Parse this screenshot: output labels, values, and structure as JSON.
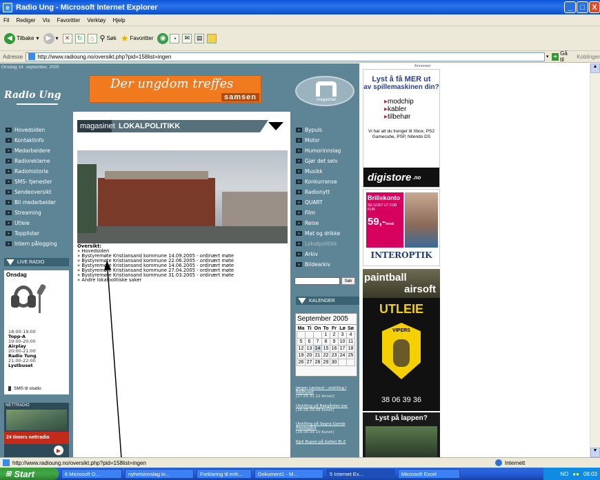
{
  "window": {
    "title": "Radio Ung - Microsoft Internet Explorer",
    "min": "_",
    "max": "□",
    "close": "X"
  },
  "menu": [
    "Fil",
    "Rediger",
    "Vis",
    "Favoritter",
    "Verktøy",
    "Hjelp"
  ],
  "toolbar": {
    "back": "Tilbake",
    "search": "Søk",
    "favorites": "Favoritter"
  },
  "address": {
    "label": "Adresse",
    "url": "http://www.radioung.no/oversikt.php?pid=158list=ingen",
    "go": "Gå til",
    "links": "Koblinger"
  },
  "page": {
    "date": "Onsdag 14. september, 2005",
    "logo": "Radio Ung",
    "banner": {
      "line1": "Der ungdom treffes",
      "line2": "samsen"
    },
    "magasinet_logo": "magasinet",
    "section": {
      "a": "magasinet",
      "b": "LOKALPOLITIKK"
    },
    "annonser": "Annonser",
    "left_nav": [
      "Hovedsiden",
      "Kontaktinfo",
      "Medarbeidere",
      "Radioreklame",
      "Radiohistorie",
      "SMS- tjenester",
      "Sendeoversikt",
      "Bli medarbeider",
      "Streaming",
      "Utleie",
      "Topplister",
      "Intern pålogging"
    ],
    "live_radio": "LIVE RADIO",
    "day": "Onsdag",
    "programs": [
      {
        "time": "18:00-19:00",
        "name": "Topp-A"
      },
      {
        "time": "19:00-20:00",
        "name": "Airplay"
      },
      {
        "time": "20:00-21:00",
        "name": "Radio Tung"
      },
      {
        "time": "21:00-22:00",
        "name": "Lystbuset"
      }
    ],
    "sms_studio": "SMS til studio",
    "nettradio": "NETTRADIO",
    "nettradio_caption": "24 timers nettradio",
    "right_nav": [
      "Bypuls",
      "Motor",
      "Humorinnslag",
      "Gjør det selv",
      "Musikk",
      "Konkurranse",
      "Radionytt",
      "QUART",
      "Film",
      "Reise",
      "Mat og drikke",
      "Lokalpolitikk",
      "Arkiv",
      "Bildearkiv"
    ],
    "search_button": "Søk",
    "kalender": "KALENDER",
    "calendar": {
      "month": "September 2005",
      "headers": [
        "Ma",
        "Ti",
        "On",
        "To",
        "Fr",
        "Lø",
        "Sø"
      ],
      "rows": [
        [
          "",
          "",
          "",
          "1",
          "2",
          "3",
          "4"
        ],
        [
          "5",
          "6",
          "7",
          "8",
          "9",
          "10",
          "11"
        ],
        [
          "12",
          "13",
          "14",
          "15",
          "16",
          "17",
          "18"
        ],
        [
          "19",
          "20",
          "21",
          "22",
          "23",
          "24",
          "25"
        ],
        [
          "26",
          "27",
          "28",
          "29",
          "30",
          "",
          ""
        ]
      ]
    },
    "events": [
      {
        "title": "Jørgen Løvland - utstilling i Rådhuset",
        "date": "[27.05-31.12 Annet]"
      },
      {
        "title": "Utstilling på Bakgården bar",
        "date": "[26.08-29.09 Kunst]"
      },
      {
        "title": "Utstilling på Sagna Gamle Prestegård",
        "date": "[28.08-09.10 Kunst]"
      },
      {
        "title": "Kjell Nupen på Galleri Bi-Z",
        "date": ""
      }
    ],
    "oversikt": {
      "heading": "Oversikt:",
      "items": [
        "Hovedsiden",
        "Bystyremøte Kristiansand kommune 14.09.2005 - ordinært møte",
        "Bystyremøte Kristiansand kommune 22.06.2005 - ordinært møte",
        "Bystyremøte Kristiansand kommune 14.06.2005 - ordinært møte",
        "Bystyremøte Kristiansand kommune 27.04.2005 - ordinært møte",
        "Bystyremøte Kristiansand kommune 31.03.2005 - ordinært møte",
        "Andre lokalpolitiske saker"
      ]
    },
    "ads": {
      "digistore": {
        "h1": "Lyst å få MER ut",
        "h2": "av spillemaskinen din?",
        "bullets": [
          "modchip",
          "kabler",
          "tilbehør"
        ],
        "body": "Vi har alt du trenger til Xbox, PS2 Gamecube, PSP, Nitendo DS",
        "brand": "digistore",
        "tld": ".no"
      },
      "interoptik": {
        "title": "Brillekonto",
        "sub": "SE GODT UT FOR KUN",
        "price": "59,-",
        "unit": "/mnd",
        "brand": "INTEROPTIK"
      },
      "paintball": {
        "l1": "paintball",
        "l2": "airsoft",
        "l3": "UTLEIE",
        "brand": "VIPERS",
        "phone": "38 06 39 36"
      },
      "lappen": "Lyst på lappen?"
    }
  },
  "status": {
    "url": "http://www.radioung.no/oversikt.php?pid=158list=ingen",
    "zone": "Internett"
  },
  "taskbar": {
    "start": "Start",
    "tasks": [
      "6 Microsoft O...",
      "nyhetsinnslag in...",
      "Forklaring til enh...",
      "Dokument1 - M...",
      "5 Internet Ex...",
      "Microsoft Excel"
    ],
    "lang": "NO",
    "time": "08:03"
  }
}
